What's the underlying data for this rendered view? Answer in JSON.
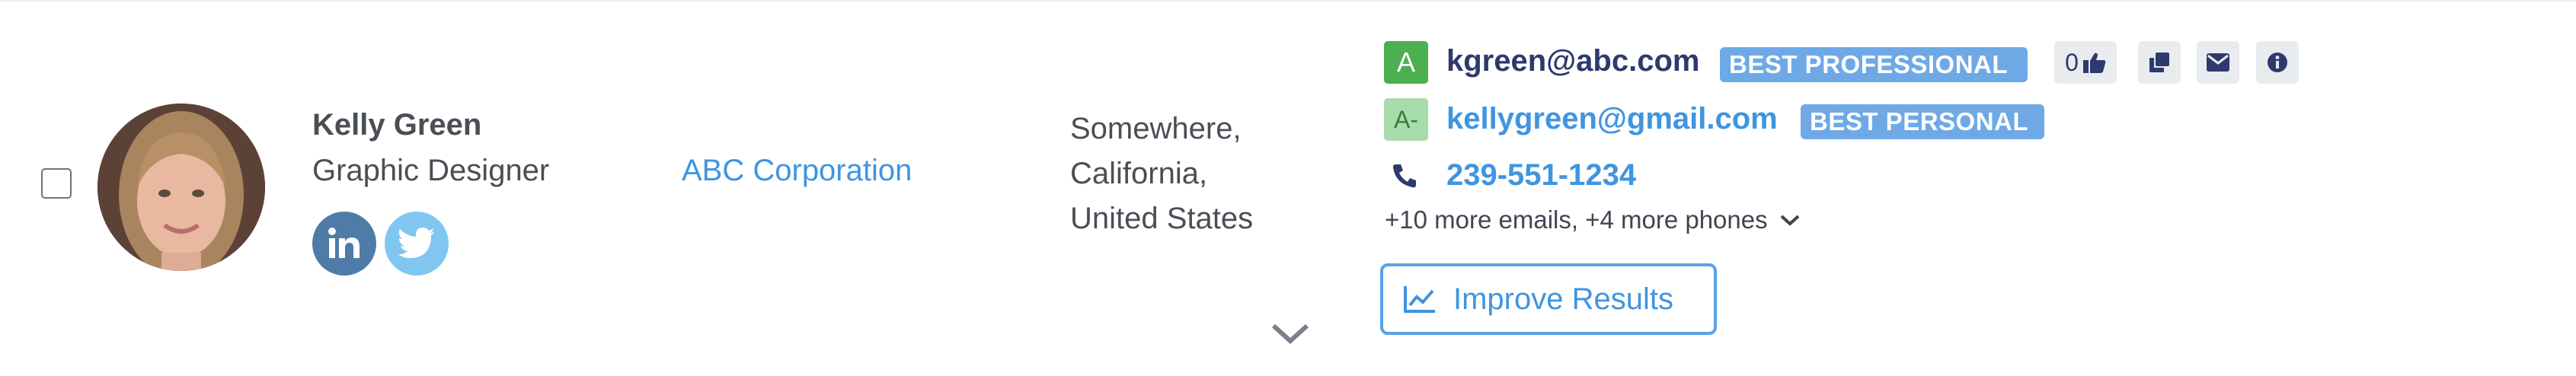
{
  "contact": {
    "name": "Kelly Green",
    "job_title": "Graphic Designer",
    "company": "ABC Corporation",
    "address_lines": [
      "Somewhere,",
      "California,",
      "United States"
    ]
  },
  "emails": [
    {
      "grade": "A",
      "address": "kgreen@abc.com",
      "badge": "BEST PROFESSIONAL"
    },
    {
      "grade": "A-",
      "address": "kellygreen@gmail.com",
      "badge": "BEST PERSONAL"
    }
  ],
  "likes_count": "0",
  "phone": "239-551-1234",
  "more_contacts": "+10 more emails, +4 more phones",
  "improve_label": "Improve Results",
  "social": {
    "linkedin_glyph": "in"
  },
  "icons": [
    "checkbox",
    "avatar",
    "linkedin-icon",
    "twitter-icon",
    "thumbs-up-icon",
    "copy-icon",
    "mail-icon",
    "info-icon",
    "phone-icon",
    "chevron-down-icon",
    "chart-line-icon"
  ],
  "colors": {
    "link": "#3f95e0",
    "badge": "#6ea9e6",
    "grade_a": "#4caf50",
    "grade_a_minus": "#a8dcab",
    "linkedin": "#4e7ca7",
    "twitter": "#80c6f1"
  }
}
